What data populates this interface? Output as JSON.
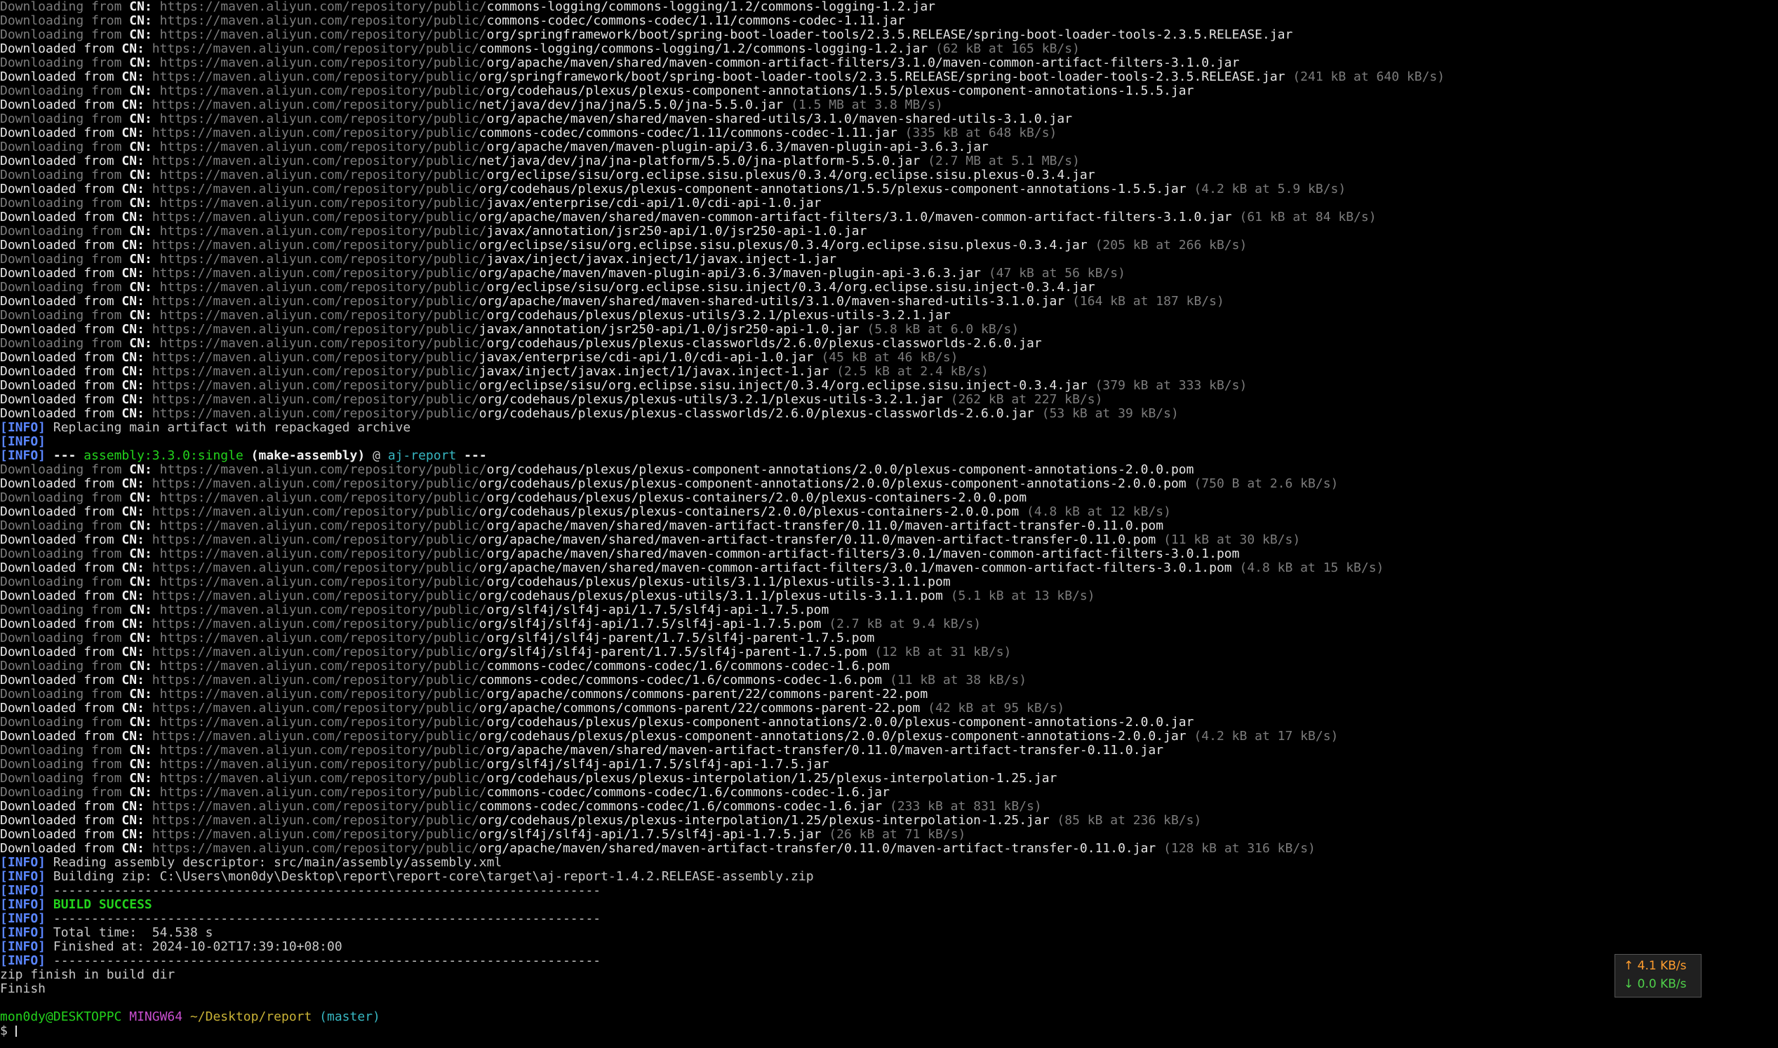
{
  "repo_base": "https://maven.aliyun.com/repository/public/",
  "dl_lines": [
    {
      "kind": "Downloading",
      "path": "commons-logging/commons-logging/1.2/commons-logging-1.2.jar",
      "size": ""
    },
    {
      "kind": "Downloading",
      "path": "commons-codec/commons-codec/1.11/commons-codec-1.11.jar",
      "size": ""
    },
    {
      "kind": "Downloading",
      "path": "org/springframework/boot/spring-boot-loader-tools/2.3.5.RELEASE/spring-boot-loader-tools-2.3.5.RELEASE.jar",
      "size": ""
    },
    {
      "kind": "Downloaded",
      "path": "commons-logging/commons-logging/1.2/commons-logging-1.2.jar",
      "size": "(62 kB at 165 kB/s)"
    },
    {
      "kind": "Downloading",
      "path": "org/apache/maven/shared/maven-common-artifact-filters/3.1.0/maven-common-artifact-filters-3.1.0.jar",
      "size": ""
    },
    {
      "kind": "Downloaded",
      "path": "org/springframework/boot/spring-boot-loader-tools/2.3.5.RELEASE/spring-boot-loader-tools-2.3.5.RELEASE.jar",
      "size": "(241 kB at 640 kB/s)"
    },
    {
      "kind": "Downloading",
      "path": "org/codehaus/plexus/plexus-component-annotations/1.5.5/plexus-component-annotations-1.5.5.jar",
      "size": ""
    },
    {
      "kind": "Downloaded",
      "path": "net/java/dev/jna/jna/5.5.0/jna-5.5.0.jar",
      "size": "(1.5 MB at 3.8 MB/s)"
    },
    {
      "kind": "Downloading",
      "path": "org/apache/maven/shared/maven-shared-utils/3.1.0/maven-shared-utils-3.1.0.jar",
      "size": ""
    },
    {
      "kind": "Downloaded",
      "path": "commons-codec/commons-codec/1.11/commons-codec-1.11.jar",
      "size": "(335 kB at 648 kB/s)"
    },
    {
      "kind": "Downloading",
      "path": "org/apache/maven/maven-plugin-api/3.6.3/maven-plugin-api-3.6.3.jar",
      "size": ""
    },
    {
      "kind": "Downloaded",
      "path": "net/java/dev/jna/jna-platform/5.5.0/jna-platform-5.5.0.jar",
      "size": "(2.7 MB at 5.1 MB/s)"
    },
    {
      "kind": "Downloading",
      "path": "org/eclipse/sisu/org.eclipse.sisu.plexus/0.3.4/org.eclipse.sisu.plexus-0.3.4.jar",
      "size": ""
    },
    {
      "kind": "Downloaded",
      "path": "org/codehaus/plexus/plexus-component-annotations/1.5.5/plexus-component-annotations-1.5.5.jar",
      "size": "(4.2 kB at 5.9 kB/s)"
    },
    {
      "kind": "Downloading",
      "path": "javax/enterprise/cdi-api/1.0/cdi-api-1.0.jar",
      "size": ""
    },
    {
      "kind": "Downloaded",
      "path": "org/apache/maven/shared/maven-common-artifact-filters/3.1.0/maven-common-artifact-filters-3.1.0.jar",
      "size": "(61 kB at 84 kB/s)"
    },
    {
      "kind": "Downloading",
      "path": "javax/annotation/jsr250-api/1.0/jsr250-api-1.0.jar",
      "size": ""
    },
    {
      "kind": "Downloaded",
      "path": "org/eclipse/sisu/org.eclipse.sisu.plexus/0.3.4/org.eclipse.sisu.plexus-0.3.4.jar",
      "size": "(205 kB at 266 kB/s)"
    },
    {
      "kind": "Downloading",
      "path": "javax/inject/javax.inject/1/javax.inject-1.jar",
      "size": ""
    },
    {
      "kind": "Downloaded",
      "path": "org/apache/maven/maven-plugin-api/3.6.3/maven-plugin-api-3.6.3.jar",
      "size": "(47 kB at 56 kB/s)"
    },
    {
      "kind": "Downloading",
      "path": "org/eclipse/sisu/org.eclipse.sisu.inject/0.3.4/org.eclipse.sisu.inject-0.3.4.jar",
      "size": ""
    },
    {
      "kind": "Downloaded",
      "path": "org/apache/maven/shared/maven-shared-utils/3.1.0/maven-shared-utils-3.1.0.jar",
      "size": "(164 kB at 187 kB/s)"
    },
    {
      "kind": "Downloading",
      "path": "org/codehaus/plexus/plexus-utils/3.2.1/plexus-utils-3.2.1.jar",
      "size": ""
    },
    {
      "kind": "Downloaded",
      "path": "javax/annotation/jsr250-api/1.0/jsr250-api-1.0.jar",
      "size": "(5.8 kB at 6.0 kB/s)"
    },
    {
      "kind": "Downloading",
      "path": "org/codehaus/plexus/plexus-classworlds/2.6.0/plexus-classworlds-2.6.0.jar",
      "size": ""
    },
    {
      "kind": "Downloaded",
      "path": "javax/enterprise/cdi-api/1.0/cdi-api-1.0.jar",
      "size": "(45 kB at 46 kB/s)"
    },
    {
      "kind": "Downloaded",
      "path": "javax/inject/javax.inject/1/javax.inject-1.jar",
      "size": "(2.5 kB at 2.4 kB/s)"
    },
    {
      "kind": "Downloaded",
      "path": "org/eclipse/sisu/org.eclipse.sisu.inject/0.3.4/org.eclipse.sisu.inject-0.3.4.jar",
      "size": "(379 kB at 333 kB/s)"
    },
    {
      "kind": "Downloaded",
      "path": "org/codehaus/plexus/plexus-utils/3.2.1/plexus-utils-3.2.1.jar",
      "size": "(262 kB at 227 kB/s)"
    },
    {
      "kind": "Downloaded",
      "path": "org/codehaus/plexus/plexus-classworlds/2.6.0/plexus-classworlds-2.6.0.jar",
      "size": "(53 kB at 39 kB/s)"
    }
  ],
  "info_replacing": "Replacing main artifact with repackaged archive",
  "assembly_header": {
    "dashes_left": "---",
    "plugin": "assembly:3.3.0:single",
    "execution": "(make-assembly)",
    "at": "@",
    "project": "aj-report",
    "dashes_right": "---"
  },
  "dl_lines_2": [
    {
      "kind": "Downloading",
      "path": "org/codehaus/plexus/plexus-component-annotations/2.0.0/plexus-component-annotations-2.0.0.pom",
      "size": ""
    },
    {
      "kind": "Downloaded",
      "path": "org/codehaus/plexus/plexus-component-annotations/2.0.0/plexus-component-annotations-2.0.0.pom",
      "size": "(750 B at 2.6 kB/s)"
    },
    {
      "kind": "Downloading",
      "path": "org/codehaus/plexus/plexus-containers/2.0.0/plexus-containers-2.0.0.pom",
      "size": ""
    },
    {
      "kind": "Downloaded",
      "path": "org/codehaus/plexus/plexus-containers/2.0.0/plexus-containers-2.0.0.pom",
      "size": "(4.8 kB at 12 kB/s)"
    },
    {
      "kind": "Downloading",
      "path": "org/apache/maven/shared/maven-artifact-transfer/0.11.0/maven-artifact-transfer-0.11.0.pom",
      "size": ""
    },
    {
      "kind": "Downloaded",
      "path": "org/apache/maven/shared/maven-artifact-transfer/0.11.0/maven-artifact-transfer-0.11.0.pom",
      "size": "(11 kB at 30 kB/s)"
    },
    {
      "kind": "Downloading",
      "path": "org/apache/maven/shared/maven-common-artifact-filters/3.0.1/maven-common-artifact-filters-3.0.1.pom",
      "size": ""
    },
    {
      "kind": "Downloaded",
      "path": "org/apache/maven/shared/maven-common-artifact-filters/3.0.1/maven-common-artifact-filters-3.0.1.pom",
      "size": "(4.8 kB at 15 kB/s)"
    },
    {
      "kind": "Downloading",
      "path": "org/codehaus/plexus/plexus-utils/3.1.1/plexus-utils-3.1.1.pom",
      "size": ""
    },
    {
      "kind": "Downloaded",
      "path": "org/codehaus/plexus/plexus-utils/3.1.1/plexus-utils-3.1.1.pom",
      "size": "(5.1 kB at 13 kB/s)"
    },
    {
      "kind": "Downloading",
      "path": "org/slf4j/slf4j-api/1.7.5/slf4j-api-1.7.5.pom",
      "size": ""
    },
    {
      "kind": "Downloaded",
      "path": "org/slf4j/slf4j-api/1.7.5/slf4j-api-1.7.5.pom",
      "size": "(2.7 kB at 9.4 kB/s)"
    },
    {
      "kind": "Downloading",
      "path": "org/slf4j/slf4j-parent/1.7.5/slf4j-parent-1.7.5.pom",
      "size": ""
    },
    {
      "kind": "Downloaded",
      "path": "org/slf4j/slf4j-parent/1.7.5/slf4j-parent-1.7.5.pom",
      "size": "(12 kB at 31 kB/s)"
    },
    {
      "kind": "Downloading",
      "path": "commons-codec/commons-codec/1.6/commons-codec-1.6.pom",
      "size": ""
    },
    {
      "kind": "Downloaded",
      "path": "commons-codec/commons-codec/1.6/commons-codec-1.6.pom",
      "size": "(11 kB at 38 kB/s)"
    },
    {
      "kind": "Downloading",
      "path": "org/apache/commons/commons-parent/22/commons-parent-22.pom",
      "size": ""
    },
    {
      "kind": "Downloaded",
      "path": "org/apache/commons/commons-parent/22/commons-parent-22.pom",
      "size": "(42 kB at 95 kB/s)"
    },
    {
      "kind": "Downloading",
      "path": "org/codehaus/plexus/plexus-component-annotations/2.0.0/plexus-component-annotations-2.0.0.jar",
      "size": ""
    },
    {
      "kind": "Downloaded",
      "path": "org/codehaus/plexus/plexus-component-annotations/2.0.0/plexus-component-annotations-2.0.0.jar",
      "size": "(4.2 kB at 17 kB/s)"
    },
    {
      "kind": "Downloading",
      "path": "org/apache/maven/shared/maven-artifact-transfer/0.11.0/maven-artifact-transfer-0.11.0.jar",
      "size": ""
    },
    {
      "kind": "Downloading",
      "path": "org/slf4j/slf4j-api/1.7.5/slf4j-api-1.7.5.jar",
      "size": ""
    },
    {
      "kind": "Downloading",
      "path": "org/codehaus/plexus/plexus-interpolation/1.25/plexus-interpolation-1.25.jar",
      "size": ""
    },
    {
      "kind": "Downloading",
      "path": "commons-codec/commons-codec/1.6/commons-codec-1.6.jar",
      "size": ""
    },
    {
      "kind": "Downloaded",
      "path": "commons-codec/commons-codec/1.6/commons-codec-1.6.jar",
      "size": "(233 kB at 831 kB/s)"
    },
    {
      "kind": "Downloaded",
      "path": "org/codehaus/plexus/plexus-interpolation/1.25/plexus-interpolation-1.25.jar",
      "size": "(85 kB at 236 kB/s)"
    },
    {
      "kind": "Downloaded",
      "path": "org/slf4j/slf4j-api/1.7.5/slf4j-api-1.7.5.jar",
      "size": "(26 kB at 71 kB/s)"
    },
    {
      "kind": "Downloaded",
      "path": "org/apache/maven/shared/maven-artifact-transfer/0.11.0/maven-artifact-transfer-0.11.0.jar",
      "size": "(128 kB at 316 kB/s)"
    }
  ],
  "info_tag": "[INFO]",
  "from_word": "from",
  "cn_word": "CN:",
  "info_reading": "Reading assembly descriptor: src/main/assembly/assembly.xml",
  "info_building": "Building zip: C:\\Users\\mon0dy\\Desktop\\report\\report-core\\target\\aj-report-1.4.2.RELEASE-assembly.zip",
  "separator": "------------------------------------------------------------------------",
  "build_success": "BUILD SUCCESS",
  "total_time": "Total time:  54.538 s",
  "finished_at": "Finished at: 2024-10-02T17:39:10+08:00",
  "zip_finish": "zip finish in build dir",
  "finish": "Finish",
  "prompt": {
    "user": "mon0dy@DESKTOPPC",
    "shell": "MINGW64",
    "path": "~/Desktop/report",
    "branch": "(master)",
    "symbol": "$"
  },
  "net_speed": {
    "up": "↑ 4.1 KB/s",
    "down": "↓ 0.0 KB/s"
  },
  "colors": {
    "background": "#000000",
    "info": "#5a86ff",
    "success": "#23d31c",
    "prompt_user": "#23d31c",
    "prompt_shell": "#c94fd0",
    "prompt_path": "#c9b236",
    "branch": "#37b7c2"
  }
}
